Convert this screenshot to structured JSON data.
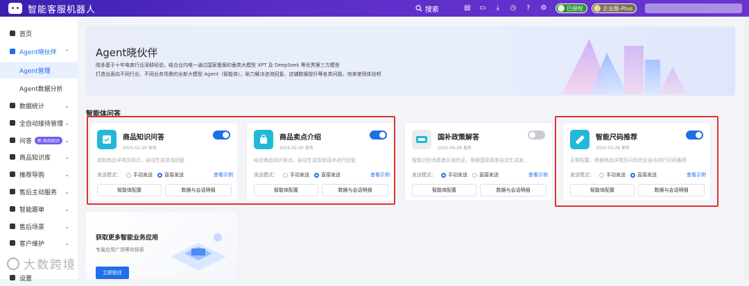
{
  "header": {
    "app_title": "智能客服机器人",
    "search_label": "搜索",
    "badge_auth": "已授权",
    "badge_plan": "企业版-Plus"
  },
  "sidebar": {
    "items": [
      {
        "label": "首页",
        "icon": "home-icon"
      },
      {
        "label": "Agent晓伙伴",
        "icon": "agent-icon"
      },
      {
        "label": "Agent管理"
      },
      {
        "label": "Agent数据分析"
      },
      {
        "label": "数据统计",
        "icon": "chart-icon"
      },
      {
        "label": "全自动接待管理",
        "icon": "auto-icon"
      },
      {
        "label": "问答",
        "icon": "qa-icon",
        "tag": "新·商品知识"
      },
      {
        "label": "商品知识库",
        "icon": "book-icon"
      },
      {
        "label": "推荐导购",
        "icon": "recommend-icon"
      },
      {
        "label": "售后主动服务",
        "icon": "service-icon"
      },
      {
        "label": "智能跟单",
        "icon": "follow-icon"
      },
      {
        "label": "售后场景",
        "icon": "scene-icon"
      },
      {
        "label": "客户维护",
        "icon": "customer-icon"
      },
      {
        "label": "设置",
        "icon": "settings-icon"
      }
    ]
  },
  "banner": {
    "title": "Agent晓伙伴",
    "line1": "晓多基于十年电商行业深耕经验，结合业内唯一通过国家备案的垂类大模型 XPT 及 DeepSeek 等优秀第三方模型",
    "line2": "打造出面向不同行业、不同业务场景的全新大模型 Agent（智能体），助力解决咨询回复、店铺数据提升等各类问题，快来使用体验吧"
  },
  "section_title": "智能体问答",
  "cards": [
    {
      "title": "商品知识问答",
      "date": "2025-02-20 发布",
      "desc": "提取商品详情页知识，自动生成咨询回复",
      "enabled": true,
      "mode_label": "发送模式：",
      "opt_manual": "手动发送",
      "opt_direct": "直接发送",
      "selected": "direct",
      "example": "查看示例",
      "btn_config": "智能体配置",
      "btn_data": "数据与会话明细"
    },
    {
      "title": "商品卖点介绍",
      "date": "2025-02-20 发布",
      "desc": "结合商品知识卖点，自动生成营销话术进行回复",
      "enabled": true,
      "mode_label": "发送模式：",
      "opt_manual": "手动发送",
      "opt_direct": "直接发送",
      "selected": "direct",
      "example": "查看示例",
      "btn_config": "智能体配置",
      "btn_data": "数据与会话明细"
    },
    {
      "title": "国补政策解答",
      "date": "2025-04-08 发布",
      "desc": "智能识别消费者区域信息，根据国家政策自动生成准...",
      "enabled": false,
      "mode_label": "发送模式：",
      "opt_manual": "手动发送",
      "opt_direct": "直接发送",
      "selected": "manual",
      "example": "查看示例",
      "btn_config": "智能体配置",
      "btn_data": "数据与会话明细"
    },
    {
      "title": "智能尺码推荐",
      "date": "2025-03-28 发布",
      "desc": "无需配置，根据商品详情页尺码信息自动进行尺码推荐",
      "enabled": true,
      "mode_label": "发送模式：",
      "opt_manual": "手动发送",
      "opt_direct": "直接发送",
      "selected": "direct",
      "example": "查看示例",
      "btn_config": "智能体配置",
      "btn_data": "数据与会话明细"
    }
  ],
  "promo": {
    "title": "获取更多智能业务应用",
    "subtitle": "专属应用广场等你探索",
    "button": "立即前往"
  },
  "watermark": "大数跨境",
  "colors": {
    "accent": "#1e6fe8",
    "topbar": "#4a27c0",
    "highlight": "#e03030"
  }
}
